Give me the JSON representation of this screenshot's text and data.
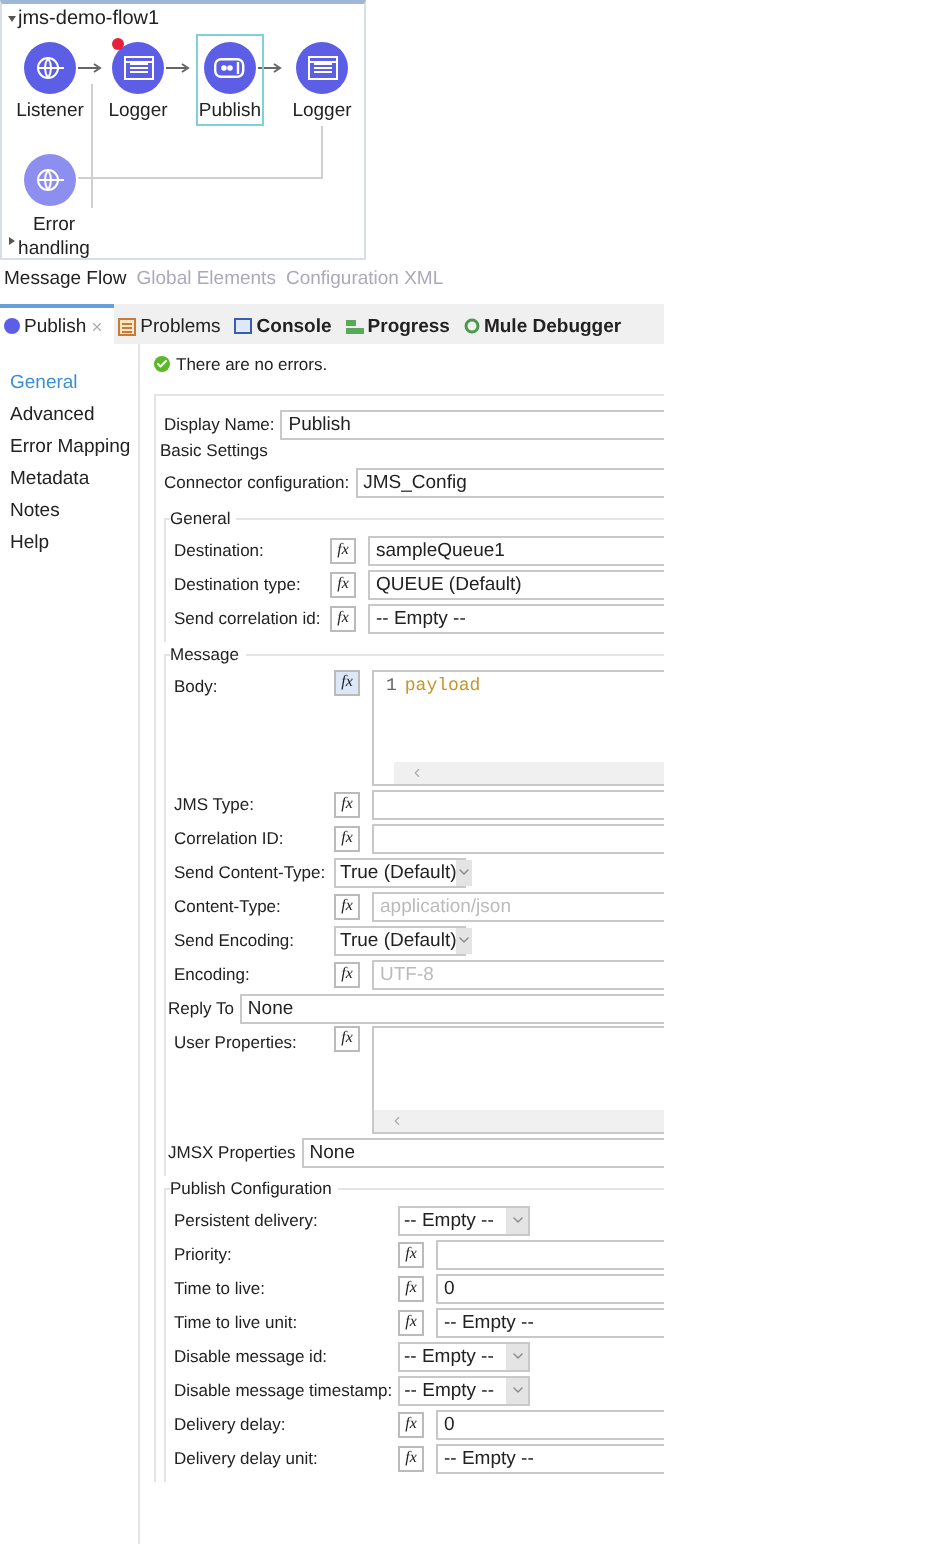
{
  "flow": {
    "title": "jms-demo-flow1",
    "nodes": [
      {
        "label": "Listener",
        "kind": "listener",
        "selected": false,
        "flagged": false
      },
      {
        "label": "Logger",
        "kind": "logger",
        "selected": false,
        "flagged": true
      },
      {
        "label": "Publish",
        "kind": "publish",
        "selected": true,
        "flagged": false
      },
      {
        "label": "Logger",
        "kind": "logger",
        "selected": false,
        "flagged": false
      }
    ],
    "error_handler": {
      "label": "Error handling",
      "kind": "listener"
    }
  },
  "editor_tabs": [
    {
      "label": "Message Flow",
      "selected": true
    },
    {
      "label": "Global Elements",
      "selected": false
    },
    {
      "label": "Configuration XML",
      "selected": false
    }
  ],
  "view_tabs": [
    {
      "label": "Publish",
      "kind": "publish",
      "selected": true,
      "closable": true
    },
    {
      "label": "Problems",
      "kind": "problems",
      "selected": false,
      "closable": false
    },
    {
      "label": "Console",
      "kind": "console",
      "selected": false,
      "closable": false
    },
    {
      "label": "Progress",
      "kind": "progress",
      "selected": false,
      "closable": false
    },
    {
      "label": "Mule Debugger",
      "kind": "debugger",
      "selected": false,
      "closable": false
    }
  ],
  "nav": [
    {
      "label": "General",
      "selected": true
    },
    {
      "label": "Advanced",
      "selected": false
    },
    {
      "label": "Error Mapping",
      "selected": false
    },
    {
      "label": "Metadata",
      "selected": false
    },
    {
      "label": "Notes",
      "selected": false
    },
    {
      "label": "Help",
      "selected": false
    }
  ],
  "status": {
    "message": "There are no errors.",
    "ok": true
  },
  "display_name": {
    "label": "Display Name:",
    "value": "Publish"
  },
  "groups": [
    {
      "title": "Basic Settings",
      "kind": "basic",
      "rows": [
        {
          "label": "Connector configuration:",
          "kind": "text",
          "value": "JMS_Config"
        }
      ]
    },
    {
      "title": "General",
      "kind": "general",
      "rows": [
        {
          "label": "Destination:",
          "kind": "fx",
          "fx": "fx",
          "value": "sampleQueue1"
        },
        {
          "label": "Destination type:",
          "kind": "fx",
          "fx": "fx",
          "value": "QUEUE (Default)"
        },
        {
          "label": "Send correlation id:",
          "kind": "fx",
          "fx": "fx",
          "value": "-- Empty --"
        }
      ]
    },
    {
      "title": "Message",
      "kind": "message",
      "rows": [
        {
          "label": "Body:",
          "kind": "code",
          "fx": "fx",
          "code": {
            "line": "1",
            "text": "payload"
          }
        },
        {
          "label": "JMS Type:",
          "kind": "fx",
          "fx": "fx"
        },
        {
          "label": "Correlation ID:",
          "kind": "fx",
          "fx": "fx"
        },
        {
          "label": "Send Content-Type:",
          "kind": "select",
          "value": "True (Default)"
        },
        {
          "label": "Content-Type:",
          "kind": "fx",
          "fx": "fx",
          "placeholder": "application/json"
        },
        {
          "label": "Send Encoding:",
          "kind": "select",
          "value": "True (Default)"
        },
        {
          "label": "Encoding:",
          "kind": "fx",
          "fx": "fx",
          "placeholder": "UTF-8"
        },
        {
          "label": "Reply To",
          "kind": "inline",
          "value": "None"
        },
        {
          "label": "User Properties:",
          "kind": "area",
          "fx": "fx"
        },
        {
          "label": "JMSX Properties",
          "kind": "inline",
          "value": "None"
        }
      ]
    },
    {
      "title": "Publish Configuration",
      "kind": "publish",
      "rows": [
        {
          "label": "Persistent delivery:",
          "kind": "select",
          "value": "-- Empty --"
        },
        {
          "label": "Priority:",
          "kind": "fx",
          "fx": "fx"
        },
        {
          "label": "Time to live:",
          "kind": "fx",
          "fx": "fx",
          "value": "0"
        },
        {
          "label": "Time to live unit:",
          "kind": "fx",
          "fx": "fx",
          "value": "-- Empty --"
        },
        {
          "label": "Disable message id:",
          "kind": "select",
          "value": "-- Empty --"
        },
        {
          "label": "Disable message timestamp:",
          "kind": "select",
          "value": "-- Empty --"
        },
        {
          "label": "Delivery delay:",
          "kind": "fx",
          "fx": "fx",
          "value": "0"
        },
        {
          "label": "Delivery delay unit:",
          "kind": "fx",
          "fx": "fx",
          "value": "-- Empty --"
        }
      ]
    }
  ]
}
